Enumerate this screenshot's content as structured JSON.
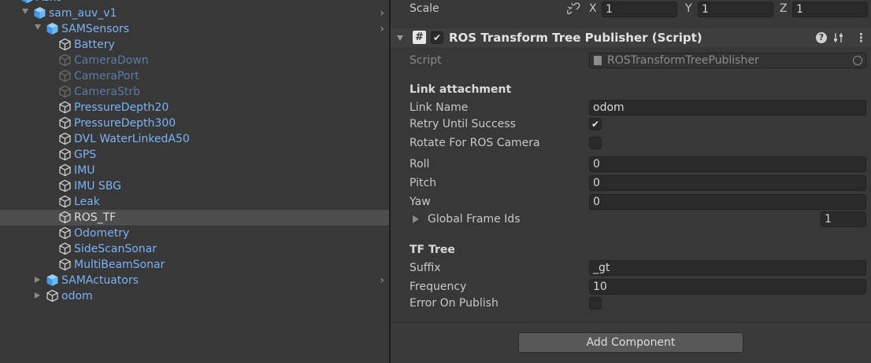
{
  "hierarchy": {
    "rows": [
      {
        "label": "Asko",
        "color": "blue",
        "icon": "prefab-cube-icon",
        "chevron": true
      },
      {
        "label": "sam_auv_v1",
        "color": "blue",
        "icon": "prefab-cube-icon",
        "chevron": true
      },
      {
        "label": "SAMSensors",
        "color": "blue",
        "icon": "prefab-cube-icon",
        "chevron": true
      },
      {
        "label": "Battery",
        "color": "blue",
        "icon": "gameobject-cube-icon"
      },
      {
        "label": "CameraDown",
        "color": "dim",
        "icon": "gameobject-cube-icon"
      },
      {
        "label": "CameraPort",
        "color": "dim",
        "icon": "gameobject-cube-icon"
      },
      {
        "label": "CameraStrb",
        "color": "dim",
        "icon": "gameobject-cube-icon"
      },
      {
        "label": "PressureDepth20",
        "color": "blue",
        "icon": "gameobject-cube-icon"
      },
      {
        "label": "PressureDepth300",
        "color": "blue",
        "icon": "gameobject-cube-icon"
      },
      {
        "label": "DVL WaterLinkedA50",
        "color": "blue",
        "icon": "gameobject-cube-icon"
      },
      {
        "label": "GPS",
        "color": "blue",
        "icon": "gameobject-cube-icon"
      },
      {
        "label": "IMU",
        "color": "blue",
        "icon": "gameobject-cube-icon"
      },
      {
        "label": "IMU SBG",
        "color": "blue",
        "icon": "gameobject-cube-icon"
      },
      {
        "label": "Leak",
        "color": "blue",
        "icon": "gameobject-cube-icon"
      },
      {
        "label": "ROS_TF",
        "color": "white",
        "icon": "gameobject-cube-icon",
        "selected": true
      },
      {
        "label": "Odometry",
        "color": "blue",
        "icon": "gameobject-cube-icon"
      },
      {
        "label": "SideScanSonar",
        "color": "blue",
        "icon": "gameobject-cube-icon"
      },
      {
        "label": "MultiBeamSonar",
        "color": "blue",
        "icon": "gameobject-cube-icon"
      },
      {
        "label": "SAMActuators",
        "color": "blue",
        "icon": "prefab-cube-icon",
        "chevron": true
      },
      {
        "label": "odom",
        "color": "blue",
        "icon": "gameobject-cube-icon"
      }
    ]
  },
  "inspector": {
    "scale": {
      "label": "Scale",
      "x_label": "X",
      "x": "1",
      "y_label": "Y",
      "y": "1",
      "z_label": "Z",
      "z": "1",
      "link_icon": "link-broken-icon"
    },
    "component": {
      "title": "ROS Transform Tree Publisher (Script)",
      "enabled": true,
      "icons": [
        "script-hash-icon",
        "help-icon",
        "preset-icon",
        "more-menu-icon"
      ]
    },
    "script": {
      "label": "Script",
      "value": "ROSTransformTreePublisher"
    },
    "link_section": {
      "header": "Link attachment",
      "link_name_label": "Link Name",
      "link_name": "odom",
      "retry_label": "Retry Until Success",
      "retry": true,
      "rotate_label": "Rotate For ROS Camera",
      "rotate": false,
      "roll_label": "Roll",
      "roll": "0",
      "pitch_label": "Pitch",
      "pitch": "0",
      "yaw_label": "Yaw",
      "yaw": "0",
      "global_ids_label": "Global Frame Ids",
      "global_ids_count": "1"
    },
    "tf_section": {
      "header": "TF Tree",
      "suffix_label": "Suffix",
      "suffix": "_gt",
      "frequency_label": "Frequency",
      "frequency": "10",
      "error_label": "Error On Publish",
      "error": false
    },
    "add_component": "Add Component"
  }
}
